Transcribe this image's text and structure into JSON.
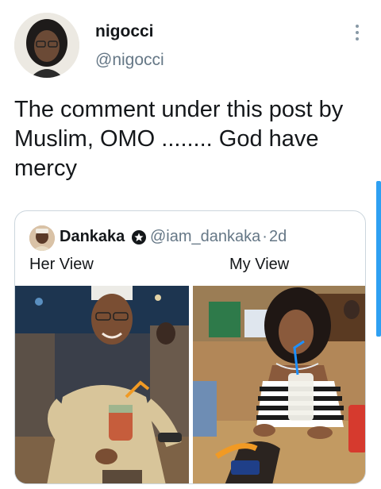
{
  "tweet": {
    "author_name": "nigocci",
    "author_handle": "@nigocci",
    "text": "The comment under this post by Muslim, OMO ........ God have mercy"
  },
  "quote": {
    "author_name": "Dankaka",
    "author_handle": "@iam_dankaka",
    "separator": "·",
    "time": "2d",
    "caption_left": "Her View",
    "caption_right": "My View"
  },
  "icons": {
    "more": "more-vertical-icon",
    "verified": "verified-badge-icon"
  },
  "colors": {
    "accent": "#2ea0f2",
    "secondary_text": "#657786",
    "border": "#ccd6dd"
  }
}
